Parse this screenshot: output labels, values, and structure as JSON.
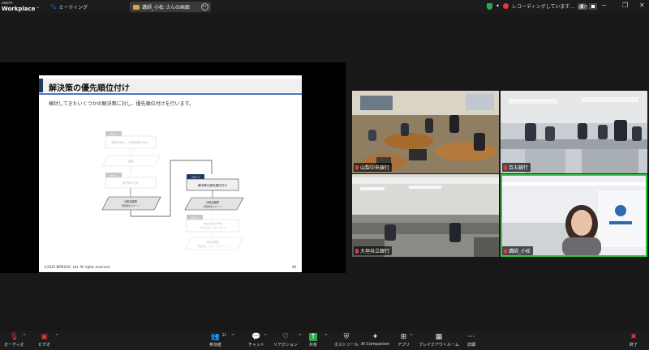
{
  "app": {
    "brand_top": "zoom",
    "brand_bottom": "Workplace"
  },
  "topbar": {
    "meeting_tab_label": "ミーティング",
    "share_pill_label": "講師_小松 さんの画面",
    "recording_label": "レコーディングしています...",
    "view_label": "表示",
    "window_controls": [
      "−",
      "❐",
      "✕"
    ]
  },
  "slide": {
    "title": "解決策の優先順位付け",
    "subtitle": "検討してきたいくつかの解決策に対し、優先順位付けを行います。",
    "footer": "©2025 BIPROGY, Ltd. All rights reserved.",
    "page_number": "40",
    "flow": {
      "step1_tag": "Step 1",
      "step1_box": "問題の見出し（状態変数の決め）",
      "issue": "問題",
      "step2_tag": "Step 2",
      "step2_box": "解決策の立案",
      "analysis1_title": "分析記録表",
      "analysis1_sub": "（問題発生のパート）",
      "step3_tag": "Step 3",
      "step3_box": "解決策の優先順位付け",
      "analysis2_title": "分析記録表",
      "analysis2_sub": "（問題発生のパート）",
      "step4_tag": "Step 4",
      "step4_box": "分析記録表の作成",
      "step4_box_sub": "（分析を記録して次に活かす）",
      "analysis3_title": "分析記録表",
      "analysis3_sub": "（問題発生、ボリュームのパート）"
    }
  },
  "participants": [
    {
      "name": "山梨中央銀行"
    },
    {
      "name": "百五銀行"
    },
    {
      "name": "大垣共立銀行"
    },
    {
      "name": "講師_小松"
    }
  ],
  "toolbar": {
    "audio": "オーディオ",
    "video": "ビデオ",
    "participants": "参加者",
    "participants_count": "21",
    "chat": "チャット",
    "reactions": "リアクション",
    "share": "共有",
    "host_tools": "ホストツール",
    "ai_companion": "AI Companion",
    "apps": "アプリ",
    "breakout": "ブレイクアウトルーム",
    "more": "詳細",
    "end": "終了"
  },
  "colors": {
    "accent_green": "#2ecc40",
    "share_green": "#2ea84f",
    "end_red": "#e03b3b",
    "slide_navy": "#1f3864"
  }
}
